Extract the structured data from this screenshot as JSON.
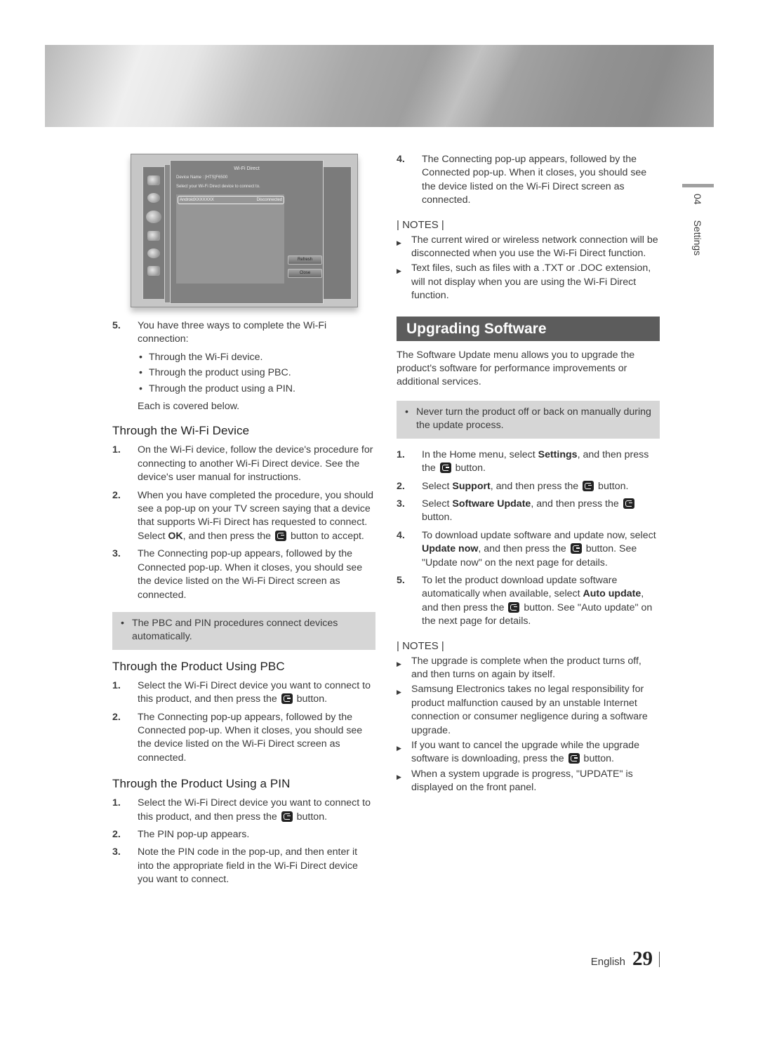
{
  "banner": {
    "icon": "decorative-header-banner"
  },
  "tv_screenshot": {
    "title": "Wi-Fi Direct",
    "device_name_line": "Device Name : [HTS]F6500",
    "instruction": "Select your Wi-Fi Direct device to connect to.",
    "device_list": [
      {
        "name": "AndroidXXXXXXX",
        "status": "Disconnected"
      }
    ],
    "buttons": [
      "Refresh",
      "Close"
    ],
    "menu_icons": [
      "picture-icon",
      "sound-icon",
      "network-icon",
      "smart-hub-icon",
      "gear-icon",
      "support-icon"
    ]
  },
  "left": {
    "step5": {
      "num": "5.",
      "text": "You have three ways to complete the Wi-Fi connection:"
    },
    "ways": [
      "Through the Wi-Fi device.",
      "Through the product using PBC.",
      "Through the product using a PIN."
    ],
    "each_covered": "Each is covered below.",
    "wifi_device": {
      "heading": "Through the Wi-Fi Device",
      "steps": [
        {
          "num": "1.",
          "text": "On the Wi-Fi device, follow the device's procedure for connecting to another Wi-Fi Direct device. See the device's user manual for instructions."
        },
        {
          "num": "2.",
          "pre": "When you have completed the procedure, you should see a pop-up on your TV screen saying that a device that supports Wi-Fi Direct has requested to connect. Select ",
          "bold": "OK",
          "mid": ", and then press the ",
          "post": " button to accept."
        },
        {
          "num": "3.",
          "text": "The Connecting pop-up appears, followed by the Connected pop-up. When it closes, you should see the device listed on the Wi-Fi Direct screen as connected."
        }
      ],
      "shaded_note": "The PBC and PIN procedures connect devices automatically."
    },
    "pbc": {
      "heading": "Through the Product Using PBC",
      "steps": [
        {
          "num": "1.",
          "pre": "Select the Wi-Fi Direct device you want to connect to this product, and then press the ",
          "post": " button."
        },
        {
          "num": "2.",
          "text": "The Connecting pop-up appears, followed by the Connected pop-up. When it closes, you should see the device listed on the Wi-Fi Direct screen as connected."
        }
      ]
    },
    "pin": {
      "heading": "Through the Product Using a PIN",
      "steps": [
        {
          "num": "1.",
          "pre": "Select the Wi-Fi Direct device you want to connect to this product, and then press the ",
          "post": " button."
        },
        {
          "num": "2.",
          "text": "The PIN pop-up appears."
        },
        {
          "num": "3.",
          "text": "Note the PIN code in the pop-up, and then enter it into the appropriate field in the Wi-Fi Direct device you want to connect."
        }
      ]
    }
  },
  "right": {
    "step4": {
      "num": "4.",
      "text": "The Connecting pop-up appears, followed by the Connected pop-up. When it closes, you should see the device listed on the Wi-Fi Direct screen as connected."
    },
    "notes1": {
      "title": "| NOTES |",
      "items": [
        "The current wired or wireless network connection will be disconnected when you use the Wi-Fi Direct function.",
        "Text files, such as files with a .TXT or .DOC extension, will not display when you are using the Wi-Fi Direct function."
      ]
    },
    "upgrading": {
      "title": "Upgrading Software",
      "intro": "The Software Update menu allows you to upgrade the product's software for performance improvements or additional services.",
      "shaded_note": "Never turn the product off or back on manually during the update process.",
      "steps": [
        {
          "num": "1.",
          "pre": "In the Home menu, select ",
          "bold": "Settings",
          "mid": ", and then press the ",
          "post": " button."
        },
        {
          "num": "2.",
          "pre": "Select ",
          "bold": "Support",
          "mid": ", and then press the ",
          "post": " button."
        },
        {
          "num": "3.",
          "pre": "Select ",
          "bold": "Software Update",
          "mid": ", and then press the ",
          "post": " button."
        },
        {
          "num": "4.",
          "pre": "To download update software and update now, select ",
          "bold": "Update now",
          "mid": ", and then press the ",
          "post": " button. See \"Update now\" on the next page for details."
        },
        {
          "num": "5.",
          "pre": "To let the product download update software automatically when available, select ",
          "bold": "Auto update",
          "mid": ", and then press the ",
          "post": " button. See \"Auto update\" on the next page for details."
        }
      ]
    },
    "notes2": {
      "title": "| NOTES |",
      "items": [
        {
          "text": "The upgrade is complete when the product turns off, and then turns on again by itself."
        },
        {
          "text": "Samsung Electronics takes no legal responsibility for product malfunction caused by an unstable Internet connection or consumer negligence during a software upgrade."
        },
        {
          "pre": "If you want to cancel the upgrade while the upgrade software is downloading, press the ",
          "post": " button."
        },
        {
          "text": "When a system upgrade is progress, \"UPDATE\" is displayed on the front panel."
        }
      ]
    }
  },
  "side_tab": {
    "chapter": "04",
    "label": "Settings"
  },
  "footer": {
    "language": "English",
    "page_number": "29"
  }
}
